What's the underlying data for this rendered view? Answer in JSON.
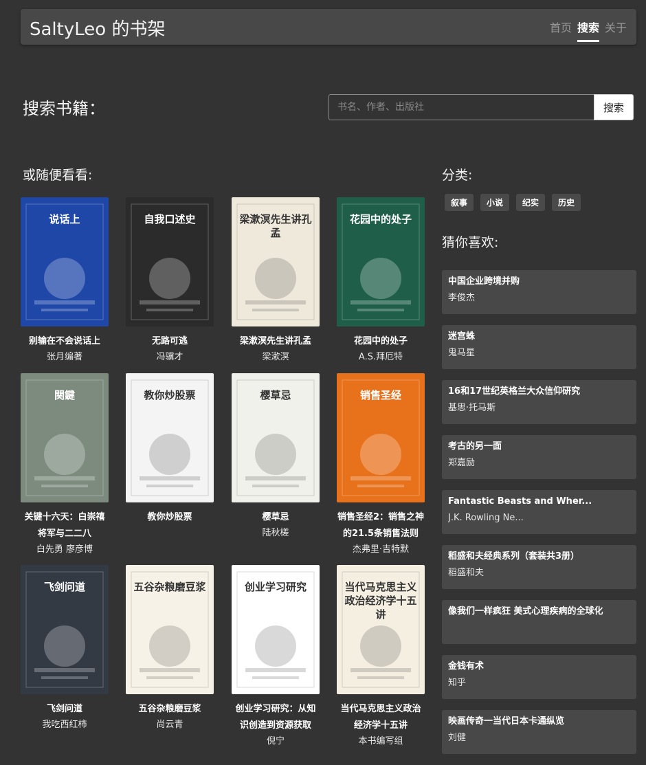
{
  "header": {
    "brand": "SaltyLeo 的书架",
    "nav": [
      "首页",
      "搜索",
      "关于"
    ],
    "active_nav": "搜索"
  },
  "search": {
    "title": "搜索书籍：",
    "placeholder": "书名、作者、出版社",
    "button": "搜索"
  },
  "random": {
    "title": "或随便看看:",
    "books": [
      {
        "title": "别输在不会说话上",
        "author": "张月编著",
        "cover_color": "#1f47a8",
        "cover_text": "说话上"
      },
      {
        "title": "无路可逃",
        "author": "冯骥才",
        "cover_color": "#2b2b2b",
        "cover_text": "自我口述史"
      },
      {
        "title": "梁漱溟先生讲孔孟",
        "author": "梁漱溟",
        "cover_color": "#efe9dc",
        "cover_text": "梁漱溟先生讲孔孟"
      },
      {
        "title": "花园中的处子",
        "author": "A.S.拜厄特",
        "cover_color": "#1f5f4a",
        "cover_text": "花园中的处子"
      },
      {
        "title": "关键十六天：白崇禧将军与二二八",
        "author": "白先勇 廖彦博",
        "cover_color": "#7d8b7f",
        "cover_text": "関鍵"
      },
      {
        "title": "教你炒股票",
        "author": "",
        "cover_color": "#f4f4f4",
        "cover_text": "教你炒股票"
      },
      {
        "title": "樱草忌",
        "author": "陆秋槎",
        "cover_color": "#f1f1ec",
        "cover_text": "樱草忌"
      },
      {
        "title": "销售圣经2：销售之神的21.5条销售法则",
        "author": "杰弗里·吉特默",
        "cover_color": "#e8721c",
        "cover_text": "销售圣经"
      },
      {
        "title": "飞剑问道",
        "author": "我吃西红柿",
        "cover_color": "#333a44",
        "cover_text": "飞剑问道"
      },
      {
        "title": "五谷杂粮磨豆浆",
        "author": "尚云青",
        "cover_color": "#f7f2e8",
        "cover_text": "五谷杂粮磨豆浆"
      },
      {
        "title": "创业学习研究：从知识创造到资源获取",
        "author": "倪宁",
        "cover_color": "#ffffff",
        "cover_text": "创业学习研究"
      },
      {
        "title": "当代马克思主义政治经济学十五讲",
        "author": "本书编写组",
        "cover_color": "#f5efe2",
        "cover_text": "当代马克思主义政治经济学十五讲"
      }
    ]
  },
  "categories": {
    "title": "分类:",
    "tags": [
      "叙事",
      "小说",
      "纪实",
      "历史"
    ]
  },
  "recommend": {
    "title": "猜你喜欢:",
    "items": [
      {
        "title": "中国企业跨境并购",
        "author": "李俊杰"
      },
      {
        "title": "迷宫蛛",
        "author": "鬼马星"
      },
      {
        "title": "16和17世纪英格兰大众信仰研究",
        "author": "基思·托马斯"
      },
      {
        "title": "考古的另一面",
        "author": "郑嘉励"
      },
      {
        "title": "Fantastic Beasts and Wher...",
        "author": "J.K. Rowling Ne..."
      },
      {
        "title": "稻盛和夫经典系列（套装共3册）",
        "author": "稻盛和夫"
      },
      {
        "title": "像我们一样疯狂 美式心理疾病的全球化",
        "author": ""
      },
      {
        "title": "金钱有术",
        "author": "知乎"
      },
      {
        "title": "映画传奇一当代日本卡通纵览",
        "author": "刘健"
      }
    ]
  }
}
